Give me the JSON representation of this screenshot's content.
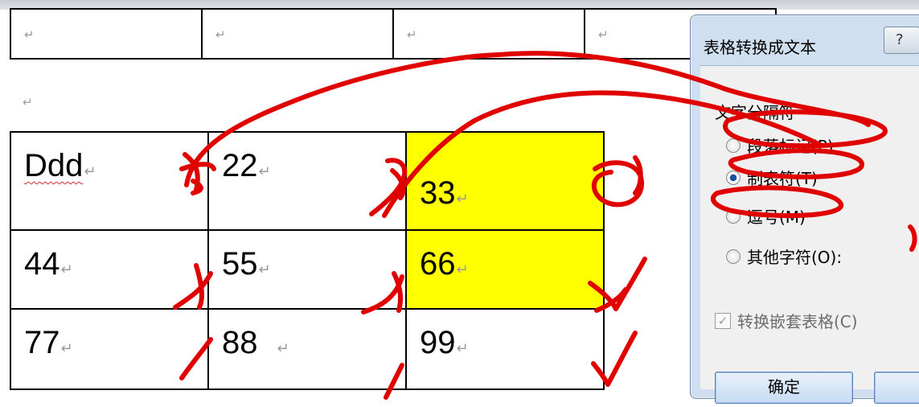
{
  "paragraph_mark": "↵",
  "top_table": {
    "cells": [
      "",
      "",
      "",
      ""
    ]
  },
  "main_table": {
    "rows": [
      [
        "Ddd",
        "22",
        "33"
      ],
      [
        "44",
        "55",
        "66"
      ],
      [
        "77",
        "88",
        "99"
      ]
    ]
  },
  "dialog": {
    "title": "表格转换成文本",
    "help_label": "?",
    "group_label": "文字分隔符",
    "options": [
      {
        "label": "段落标记(P)",
        "checked": false
      },
      {
        "label": "制表符(T)",
        "checked": true
      },
      {
        "label": "逗号(M)",
        "checked": false
      },
      {
        "label": "其他字符(O):",
        "checked": false
      }
    ],
    "nested_checkbox_label": "转换嵌套表格(C)",
    "nested_checked": true,
    "ok_label": "确定",
    "cancel_label": ""
  },
  "colors": {
    "highlight": "#ffff00",
    "ink": "#e00000",
    "dialog_frame": "#cfdff0"
  },
  "icons": [
    "paragraph-mark-icon",
    "help-icon",
    "radio-icon",
    "checkbox-icon"
  ]
}
